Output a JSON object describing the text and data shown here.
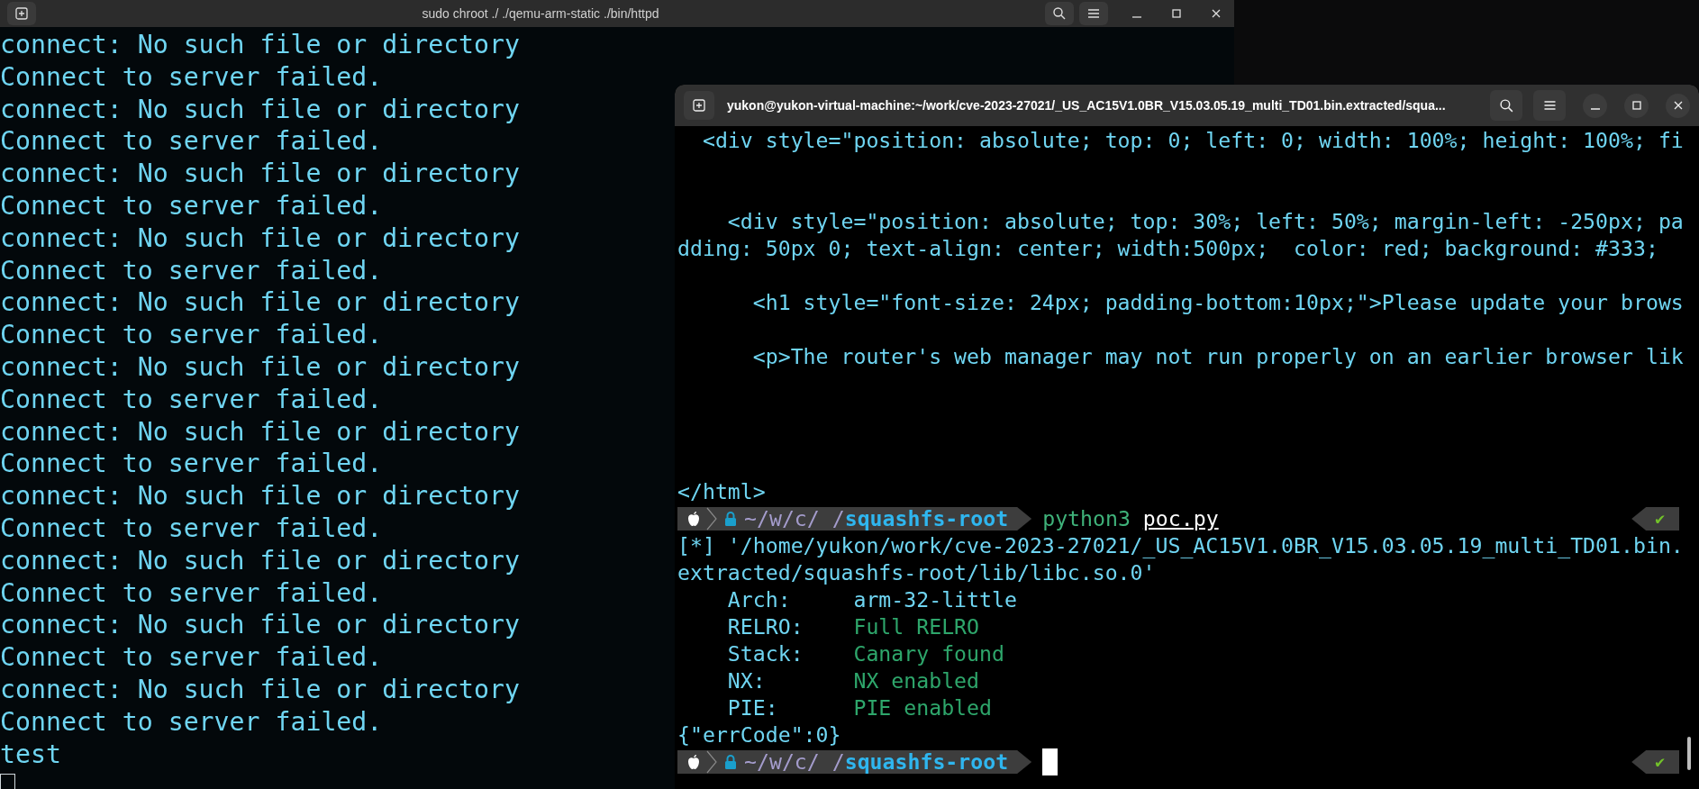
{
  "back_terminal": {
    "title": "sudo chroot ./ ./qemu-arm-static ./bin/httpd",
    "focused": false,
    "lines": [
      "connect: No such file or directory",
      "Connect to server failed.",
      "connect: No such file or directory",
      "Connect to server failed.",
      "connect: No such file or directory",
      "Connect to server failed.",
      "connect: No such file or directory",
      "Connect to server failed.",
      "connect: No such file or directory",
      "Connect to server failed.",
      "connect: No such file or directory",
      "Connect to server failed.",
      "connect: No such file or directory",
      "Connect to server failed.",
      "connect: No such file or directory",
      "Connect to server failed.",
      "connect: No such file or directory",
      "Connect to server failed.",
      "connect: No such file or directory",
      "Connect to server failed.",
      "connect: No such file or directory",
      "Connect to server failed.",
      "test"
    ]
  },
  "front_terminal": {
    "title": "yukon@yukon-virtual-machine:~/work/cve-2023-27021/_US_AC15V1.0BR_V15.03.05.19_multi_TD01.bin.extracted/squa...",
    "focused": true,
    "rows": [
      {
        "kind": "text",
        "text": "  <div style=\"position: absolute; top: 0; left: 0; width: 100%; height: 100%; fi"
      },
      {
        "kind": "blank"
      },
      {
        "kind": "blank"
      },
      {
        "kind": "text",
        "text": "    <div style=\"position: absolute; top: 30%; left: 50%; margin-left: -250px; pa"
      },
      {
        "kind": "text",
        "text": "dding: 50px 0; text-align: center; width:500px;  color: red; background: #333;"
      },
      {
        "kind": "blank"
      },
      {
        "kind": "text",
        "text": "      <h1 style=\"font-size: 24px; padding-bottom:10px;\">Please update your brows"
      },
      {
        "kind": "blank"
      },
      {
        "kind": "text",
        "text": "      <p>The router's web manager may not run properly on an earlier browser lik"
      },
      {
        "kind": "blank"
      },
      {
        "kind": "blank"
      },
      {
        "kind": "blank"
      },
      {
        "kind": "blank"
      },
      {
        "kind": "text",
        "text": "</html>"
      },
      {
        "kind": "prompt",
        "path": "~/w/c/_/**squashfs-root**",
        "command": "python3",
        "argument": "poc.py",
        "status": "✔"
      },
      {
        "kind": "text",
        "text": "[*] '/home/yukon/work/cve-2023-27021/_US_AC15V1.0BR_V15.03.05.19_multi_TD01.bin."
      },
      {
        "kind": "text",
        "text": "extracted/squashfs-root/lib/libc.so.0'"
      },
      {
        "kind": "field",
        "label": "Arch:",
        "value": "arm-32-little",
        "good": false
      },
      {
        "kind": "field",
        "label": "RELRO:",
        "value": "Full RELRO",
        "good": true
      },
      {
        "kind": "field",
        "label": "Stack:",
        "value": "Canary found",
        "good": true
      },
      {
        "kind": "field",
        "label": "NX:",
        "value": "NX enabled",
        "good": true
      },
      {
        "kind": "field",
        "label": "PIE:",
        "value": "PIE enabled",
        "good": true
      },
      {
        "kind": "text",
        "text": "{\"errCode\":0}"
      },
      {
        "kind": "prompt",
        "path": "~/w/c/_/**squashfs-root**",
        "status": "✔",
        "cursor": true
      }
    ]
  }
}
